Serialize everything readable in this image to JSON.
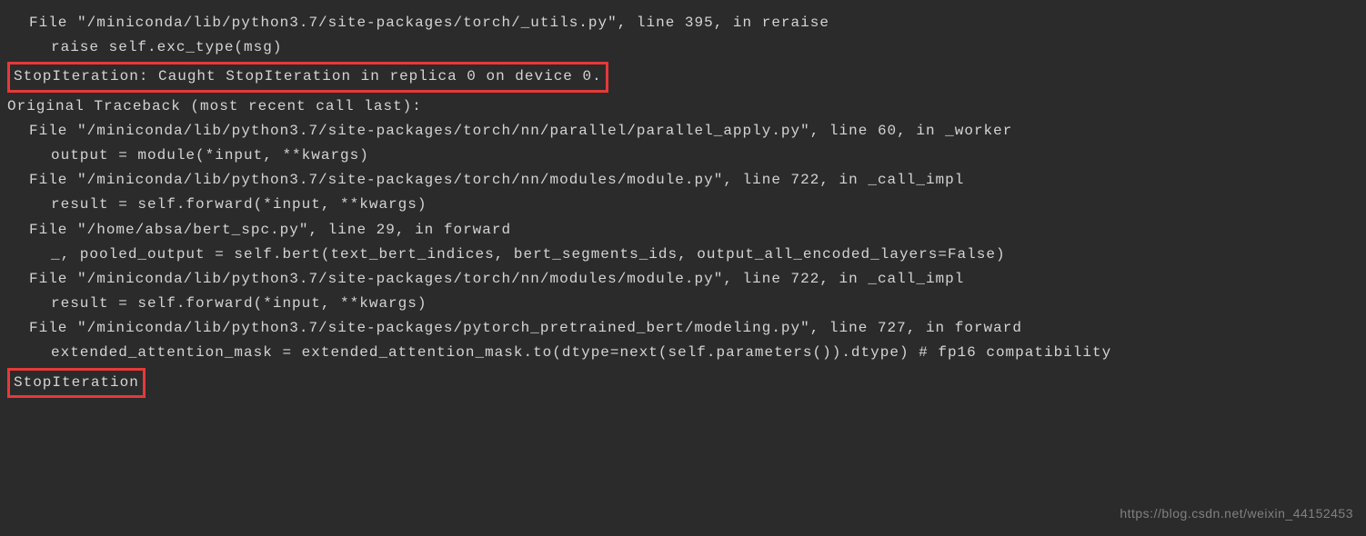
{
  "traceback": {
    "lines": [
      {
        "indent": 1,
        "text": "File \"/miniconda/lib/python3.7/site-packages/torch/_utils.py\", line 395, in reraise"
      },
      {
        "indent": 2,
        "text": "raise self.exc_type(msg)"
      }
    ],
    "highlight1": "StopIteration: Caught StopIteration in replica 0 on device 0.",
    "original_header": "Original Traceback (most recent call last):",
    "original_lines": [
      {
        "indent": 1,
        "text": "File \"/miniconda/lib/python3.7/site-packages/torch/nn/parallel/parallel_apply.py\", line 60, in _worker"
      },
      {
        "indent": 2,
        "text": "output = module(*input, **kwargs)"
      },
      {
        "indent": 1,
        "text": "File \"/miniconda/lib/python3.7/site-packages/torch/nn/modules/module.py\", line 722, in _call_impl"
      },
      {
        "indent": 2,
        "text": "result = self.forward(*input, **kwargs)"
      },
      {
        "indent": 1,
        "text": "File \"/home/absa/bert_spc.py\", line 29, in forward"
      },
      {
        "indent": 2,
        "text": "_, pooled_output = self.bert(text_bert_indices, bert_segments_ids, output_all_encoded_layers=False)"
      },
      {
        "indent": 1,
        "text": "File \"/miniconda/lib/python3.7/site-packages/torch/nn/modules/module.py\", line 722, in _call_impl"
      },
      {
        "indent": 2,
        "text": "result = self.forward(*input, **kwargs)"
      },
      {
        "indent": 1,
        "text": "File \"/miniconda/lib/python3.7/site-packages/pytorch_pretrained_bert/modeling.py\", line 727, in forward"
      },
      {
        "indent": 2,
        "text": "extended_attention_mask = extended_attention_mask.to(dtype=next(self.parameters()).dtype) # fp16 compatibility"
      }
    ],
    "highlight2": "StopIteration"
  },
  "watermark": "https://blog.csdn.net/weixin_44152453"
}
